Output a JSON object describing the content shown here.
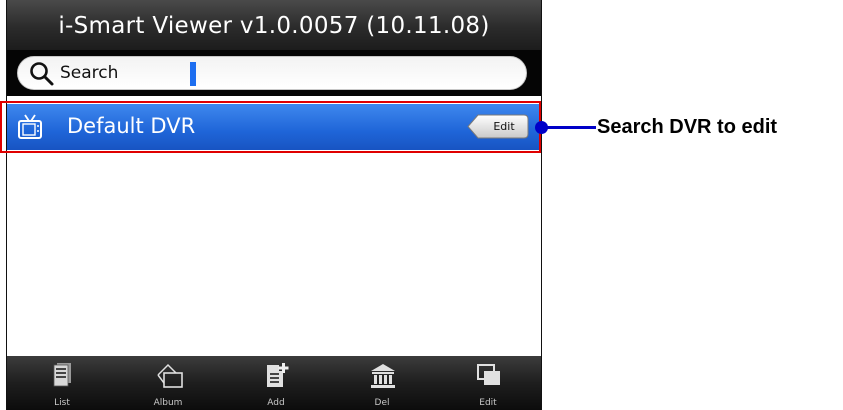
{
  "app": {
    "title": "i-Smart Viewer v1.0.0057 (10.11.08)"
  },
  "search": {
    "placeholder": "Search"
  },
  "dvr_list": [
    {
      "name": "Default DVR",
      "edit_label": "Edit",
      "icon": "tv-icon"
    }
  ],
  "annotation": {
    "text": "Search DVR to edit",
    "line_color": "#0000c8",
    "box_color": "#e00000"
  },
  "tabbar": {
    "tabs": [
      {
        "label": "List",
        "icon": "list-icon"
      },
      {
        "label": "Album",
        "icon": "album-icon"
      },
      {
        "label": "Add",
        "icon": "add-icon"
      },
      {
        "label": "Del",
        "icon": "delete-icon"
      },
      {
        "label": "Edit",
        "icon": "edit-icon"
      }
    ]
  },
  "colors": {
    "selected_row": "#1f65d8",
    "caret": "#1d6ef0"
  }
}
